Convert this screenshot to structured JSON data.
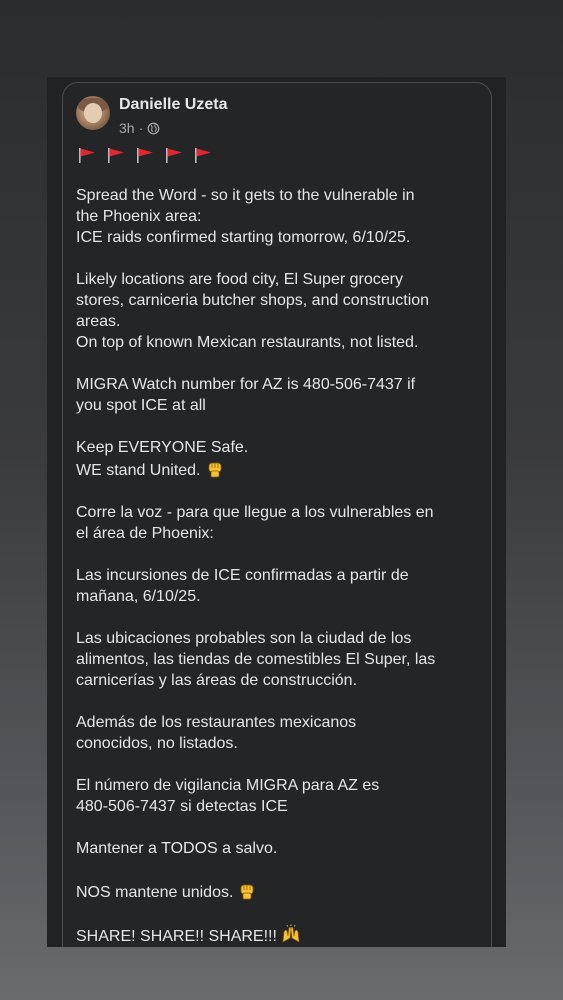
{
  "post": {
    "author": "Danielle Uzeta",
    "time": "3h",
    "separator": "·",
    "audience_icon": "globe-icon",
    "flags": [
      "triangular-flag-icon",
      "triangular-flag-icon",
      "triangular-flag-icon",
      "triangular-flag-icon",
      "triangular-flag-icon"
    ],
    "body": [
      [
        "Spread the Word - so it gets to the vulnerable in",
        "the Phoenix area:",
        "ICE raids confirmed starting tomorrow, 6/10/25."
      ],
      [
        "Likely locations are food city, El Super grocery",
        "stores, carniceria butcher shops, and construction",
        "areas.",
        "On top of known Mexican restaurants, not listed."
      ],
      [
        "MIGRA Watch number for AZ is 480-506-7437 if",
        "you spot ICE at all"
      ],
      [
        "Keep EVERYONE Safe.",
        "WE stand United."
      ],
      [
        "Corre la voz - para que llegue a los vulnerables en",
        "el área de Phoenix:"
      ],
      [
        "Las incursiones de ICE confirmadas a partir de",
        "mañana, 6/10/25."
      ],
      [
        "Las ubicaciones probables son la ciudad de los",
        "alimentos, las tiendas de comestibles El Super, las",
        "carnicerías y las áreas de construcción."
      ],
      [
        "Además de los restaurantes mexicanos",
        "conocidos, no listados."
      ],
      [
        "El número de vigilancia MIGRA para AZ es",
        "480-506-7437 si detectas ICE"
      ],
      [
        "Mantener a TODOS a salvo."
      ],
      [
        "NOS mantene unidos."
      ],
      [
        "SHARE! SHARE!! SHARE!!!"
      ]
    ],
    "emojis": {
      "3": "raised-fist-icon",
      "10": "raised-fist-icon",
      "11": "raising-hands-icon"
    }
  },
  "colors": {
    "background": "#2a2c2e",
    "card": "#232527",
    "text": "#e4e6ea",
    "secondary_text": "#a7a9ae",
    "flag_red": "#e0262e",
    "fist_yellow": "#f6c234"
  }
}
